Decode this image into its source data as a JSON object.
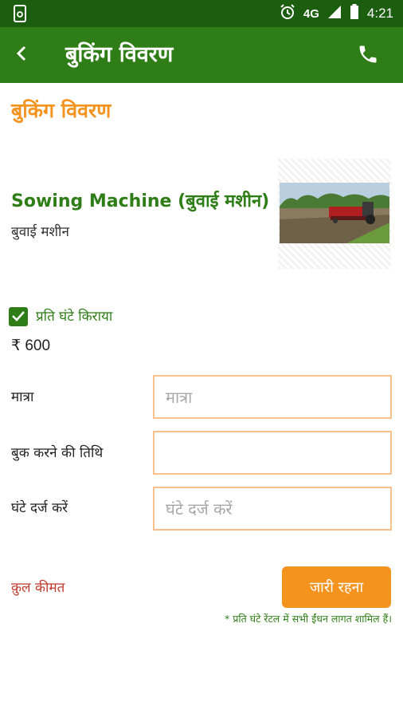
{
  "status_bar": {
    "network": "4G",
    "time": "4:21"
  },
  "app_bar": {
    "title": "बुकिंग विवरण",
    "back_icon": "back-arrow-icon",
    "phone_icon": "phone-icon"
  },
  "page": {
    "heading": "बुकिंग विवरण"
  },
  "product": {
    "name": "Sowing Machine (बुवाई मशीन)",
    "subtitle": "बुवाई मशीन",
    "image": "sowing-machine-photo"
  },
  "rent_option": {
    "label": "प्रति घंटे किराया",
    "checked": true,
    "price": "₹ 600"
  },
  "form": {
    "quantity": {
      "label": "मात्रा",
      "placeholder": "मात्रा",
      "value": ""
    },
    "booking_date": {
      "label": "बुक करने की तिथि",
      "placeholder": "",
      "value": ""
    },
    "hours": {
      "label": "घंटे दर्ज करें",
      "placeholder": "घंटे दर्ज करें",
      "value": ""
    }
  },
  "footer": {
    "total_label": "क़ुल कीमत",
    "continue_label": "जारी रहना",
    "note": "* प्रति घंटे रेंटल में सभी ईंधन लागत शामिल हैं।"
  },
  "colors": {
    "status_bar": "#1c5e10",
    "app_bar": "#2e7d16",
    "accent_orange": "#f5931f",
    "input_border": "#f8c08a",
    "total_red": "#c0392b"
  }
}
